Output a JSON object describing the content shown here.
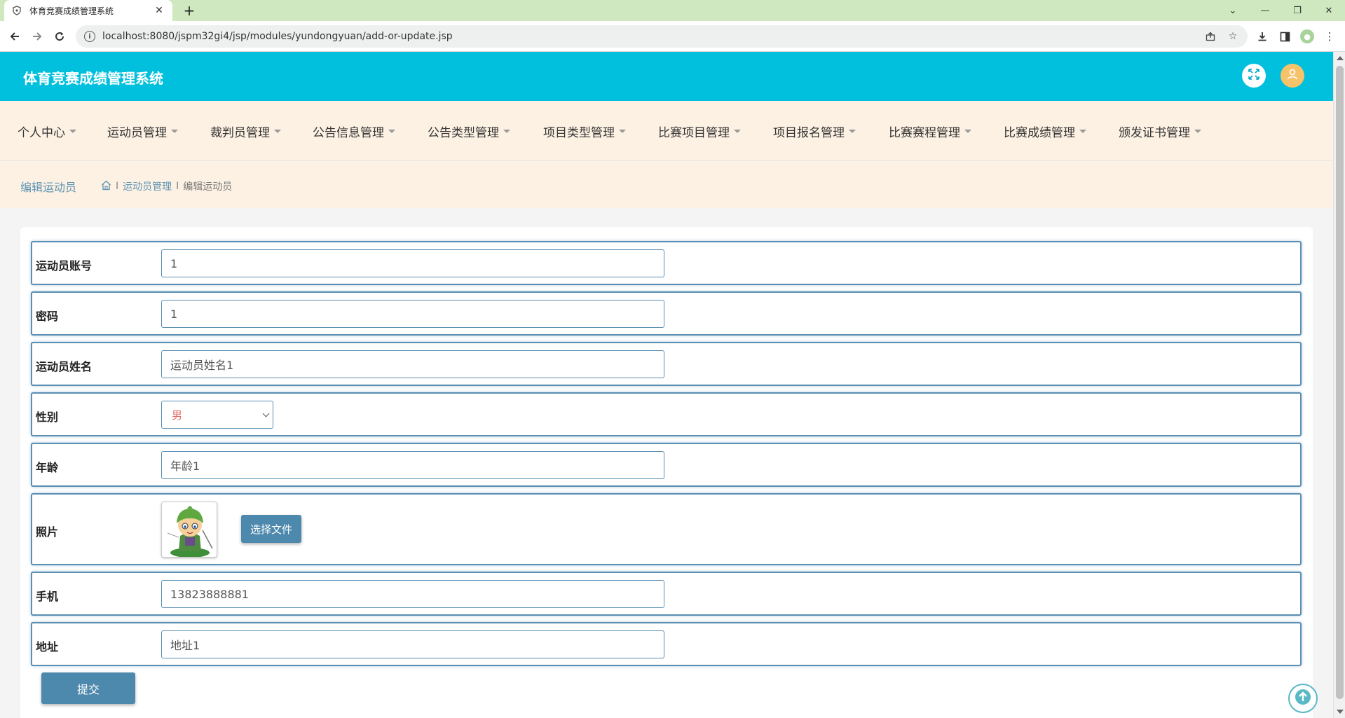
{
  "browser": {
    "tab_title": "体育竞赛成绩管理系统",
    "url": "localhost:8080/jspm32gi4/jsp/modules/yundongyuan/add-or-update.jsp"
  },
  "app": {
    "title": "体育竞赛成绩管理系统"
  },
  "menu": [
    {
      "label": "个人中心"
    },
    {
      "label": "运动员管理"
    },
    {
      "label": "裁判员管理"
    },
    {
      "label": "公告信息管理"
    },
    {
      "label": "公告类型管理"
    },
    {
      "label": "项目类型管理"
    },
    {
      "label": "比赛项目管理"
    },
    {
      "label": "项目报名管理"
    },
    {
      "label": "比赛赛程管理"
    },
    {
      "label": "比赛成绩管理"
    },
    {
      "label": "颁发证书管理"
    }
  ],
  "breadcrumb": {
    "page_title": "编辑运动员",
    "section": "运动员管理",
    "current": "编辑运动员",
    "separator": "I"
  },
  "form": {
    "account": {
      "label": "运动员账号",
      "value": "1"
    },
    "password": {
      "label": "密码",
      "value": "1"
    },
    "name": {
      "label": "运动员姓名",
      "value": "运动员姓名1"
    },
    "gender": {
      "label": "性别",
      "value": "男"
    },
    "age": {
      "label": "年龄",
      "value": "年龄1"
    },
    "photo": {
      "label": "照片",
      "button": "选择文件"
    },
    "phone": {
      "label": "手机",
      "value": "13823888881"
    },
    "address": {
      "label": "地址",
      "value": "地址1"
    },
    "submit": "提交"
  },
  "icons": {
    "fullscreen": "expand-arrows-icon",
    "user": "user-avatar-icon",
    "home": "home-icon",
    "back_to_top": "arrow-up-circle-icon"
  },
  "colors": {
    "header": "#00c0dd",
    "menubar": "#fdf1e3",
    "accent": "#4d88ad",
    "field_border": "#5a8eb3",
    "breadcrumb_text": "#5d94b4",
    "select_text": "#e06666"
  }
}
